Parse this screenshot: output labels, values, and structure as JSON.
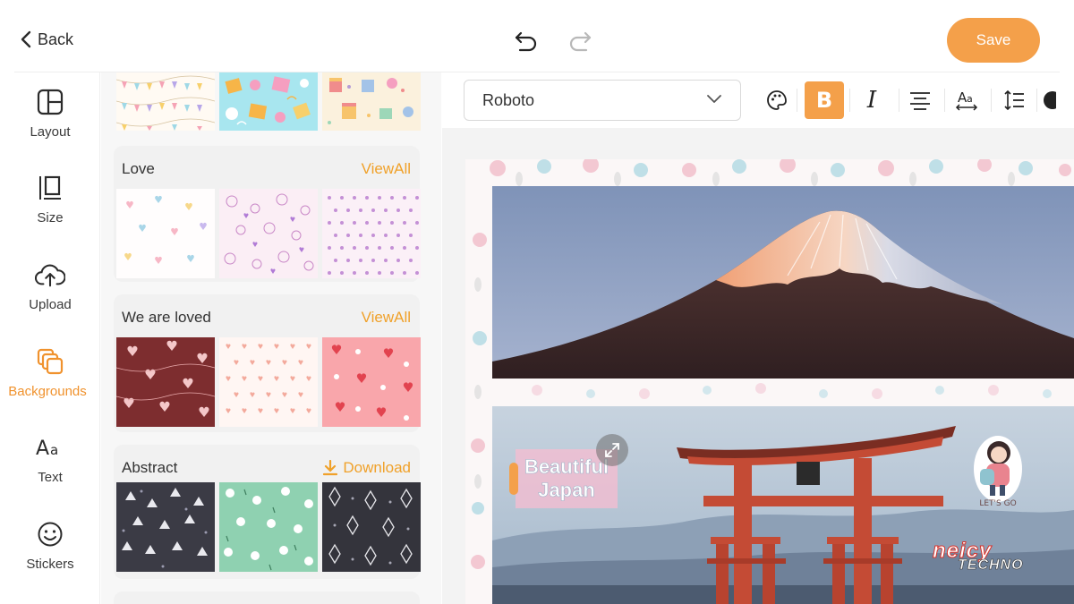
{
  "topbar": {
    "back_label": "Back",
    "save_label": "Save"
  },
  "rail": {
    "items": [
      {
        "label": "Layout",
        "icon": "layout-icon"
      },
      {
        "label": "Size",
        "icon": "size-icon"
      },
      {
        "label": "Upload",
        "icon": "upload-cloud-icon"
      },
      {
        "label": "Backgrounds",
        "icon": "backgrounds-icon",
        "active": true
      },
      {
        "label": "Text",
        "icon": "text-icon"
      },
      {
        "label": "Stickers",
        "icon": "smiley-icon"
      }
    ]
  },
  "panel": {
    "sections": [
      {
        "title": "Love",
        "action": "ViewAll"
      },
      {
        "title": "We are loved",
        "action": "ViewAll"
      },
      {
        "title": "Abstract",
        "action": "Download"
      }
    ]
  },
  "toolbar": {
    "font": "Roboto",
    "bold_label": "B",
    "italic_label": "I"
  },
  "canvas": {
    "text_line_1": "Beautiful",
    "text_line_2": "Japan",
    "sticker_text": "LET'S GO",
    "watermark_line_1": "neicy",
    "watermark_line_2": "TECHNO"
  },
  "colors": {
    "accent": "#f4a04a",
    "link": "#f0a12a"
  }
}
